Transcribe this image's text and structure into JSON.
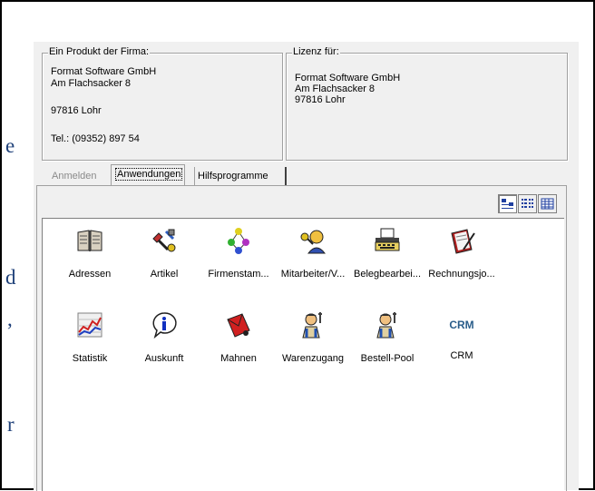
{
  "background_fragments": [
    "e",
    "d",
    ",",
    "r"
  ],
  "producer_group": {
    "title": "Ein Produkt der Firma:",
    "lines": [
      "Format Software GmbH",
      "Am Flachsacker 8",
      "97816 Lohr",
      "Tel.: (09352) 897 54"
    ]
  },
  "license_group": {
    "title": "Lizenz für:",
    "lines": [
      "Format Software GmbH",
      "Am Flachsacker 8",
      "97816 Lohr"
    ]
  },
  "tabs": [
    {
      "label": "Anmelden",
      "state": "inactive"
    },
    {
      "label": "Anwendungen",
      "state": "active"
    },
    {
      "label": "Hilfsprogramme",
      "state": "inactive"
    }
  ],
  "view_buttons": [
    "large-icons-view",
    "list-view",
    "details-view"
  ],
  "applications": [
    {
      "label": "Adressen",
      "icon": "address-book-icon"
    },
    {
      "label": "Artikel",
      "icon": "tools-icon"
    },
    {
      "label": "Firmenstam...",
      "icon": "company-network-icon"
    },
    {
      "label": "Mitarbeiter/V...",
      "icon": "employee-key-icon"
    },
    {
      "label": "Belegbearbei...",
      "icon": "typewriter-icon"
    },
    {
      "label": "Rechnungsjo...",
      "icon": "invoice-journal-icon"
    },
    {
      "label": "Statistik",
      "icon": "statistics-chart-icon"
    },
    {
      "label": "Auskunft",
      "icon": "info-icon"
    },
    {
      "label": "Mahnen",
      "icon": "dunning-letter-icon"
    },
    {
      "label": "Warenzugang",
      "icon": "worker-icon"
    },
    {
      "label": "Bestell-Pool",
      "icon": "worker-icon"
    },
    {
      "label": "CRM",
      "icon": "crm-text-icon",
      "icon_text": "CRM"
    }
  ],
  "colors": {
    "window": "#f0f0f0",
    "list_bg": "#ffffff",
    "crm_text": "#2a5d8a",
    "background_text": "#1d3f78"
  }
}
